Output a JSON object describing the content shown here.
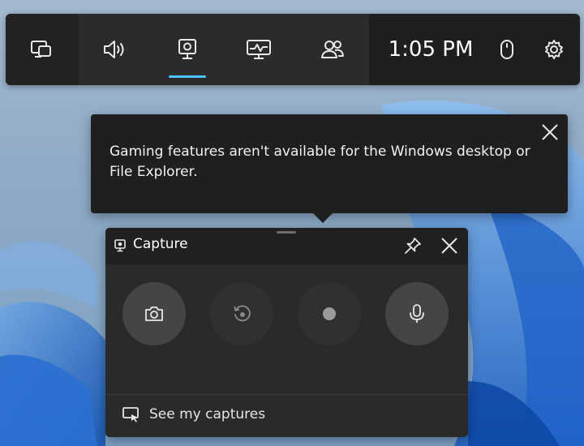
{
  "gamebar": {
    "buttons": [
      {
        "icon": "widget-menu-icon"
      },
      {
        "icon": "audio-icon"
      },
      {
        "icon": "capture-icon",
        "active": true
      },
      {
        "icon": "performance-icon"
      },
      {
        "icon": "social-icon"
      }
    ],
    "time": "1:05 PM",
    "right_icons": [
      "mouse-icon",
      "settings-icon"
    ],
    "accent_color": "#4cc2ff"
  },
  "toast": {
    "message": "Gaming features aren't available for the Windows desktop or File Explorer."
  },
  "capture": {
    "title": "Capture",
    "buttons": [
      {
        "icon": "camera-icon",
        "enabled": true
      },
      {
        "icon": "record-last-icon",
        "enabled": false
      },
      {
        "icon": "record-icon",
        "enabled": false
      },
      {
        "icon": "microphone-icon",
        "enabled": true
      }
    ],
    "footer_link": "See my captures"
  }
}
